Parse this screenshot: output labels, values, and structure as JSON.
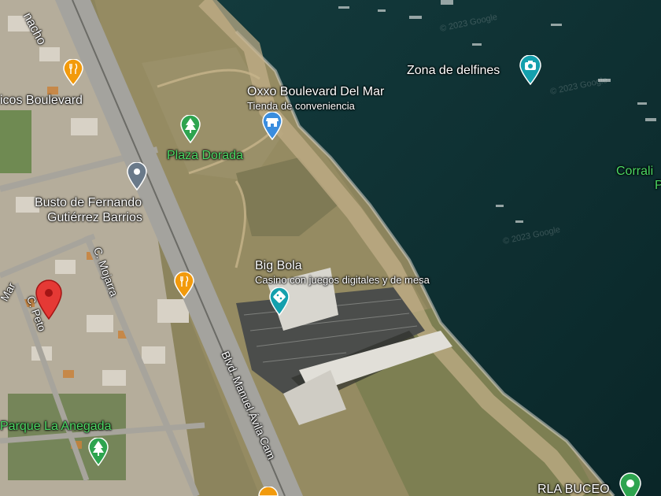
{
  "map": {
    "colors": {
      "sea": "#0f3034",
      "sea_deep": "#0b2a2c",
      "beach": "#b8a27b",
      "land": "#8c845d",
      "urban": "#b7b0a0",
      "highway": "#9b9a95",
      "lot": "#4c4e4c",
      "red_pin": "#e53935",
      "orange_pin": "#f29a0c",
      "green_pin": "#2ea44f",
      "blue_pin": "#3a8dde",
      "teal_pin": "#14a0ad",
      "gray_pin": "#6a7a8a"
    },
    "watermarks": [
      "© 2023 Google",
      "© 2023 Google",
      "© 2023 Google"
    ]
  },
  "places": {
    "zona_delfines": "Zona de delfines",
    "oxxo_name": "Oxxo Boulevard Del Mar",
    "oxxo_category": "Tienda de conveniencia",
    "plaza_dorada": "Plaza Dorada",
    "busto_line1": "Busto de Fernando",
    "busto_line2": "Gutiérrez Barrios",
    "big_bola_name": "Big Bola",
    "big_bola_category": "Casino con juegos digitales y de mesa",
    "parque": "Parque La Anegada",
    "rla_buceo": "RLA BUCEO",
    "corrali": "Corrali",
    "corrali_2": "P",
    "boulevard_partial": "icos Boulevard",
    "nacho_partial": "nacho",
    "mar_partial": "Mar"
  },
  "streets": {
    "mojarra": "C. Mojarra",
    "peto": "C. Peto",
    "blvd": "Blvd. Manuel Ávila Cam"
  }
}
